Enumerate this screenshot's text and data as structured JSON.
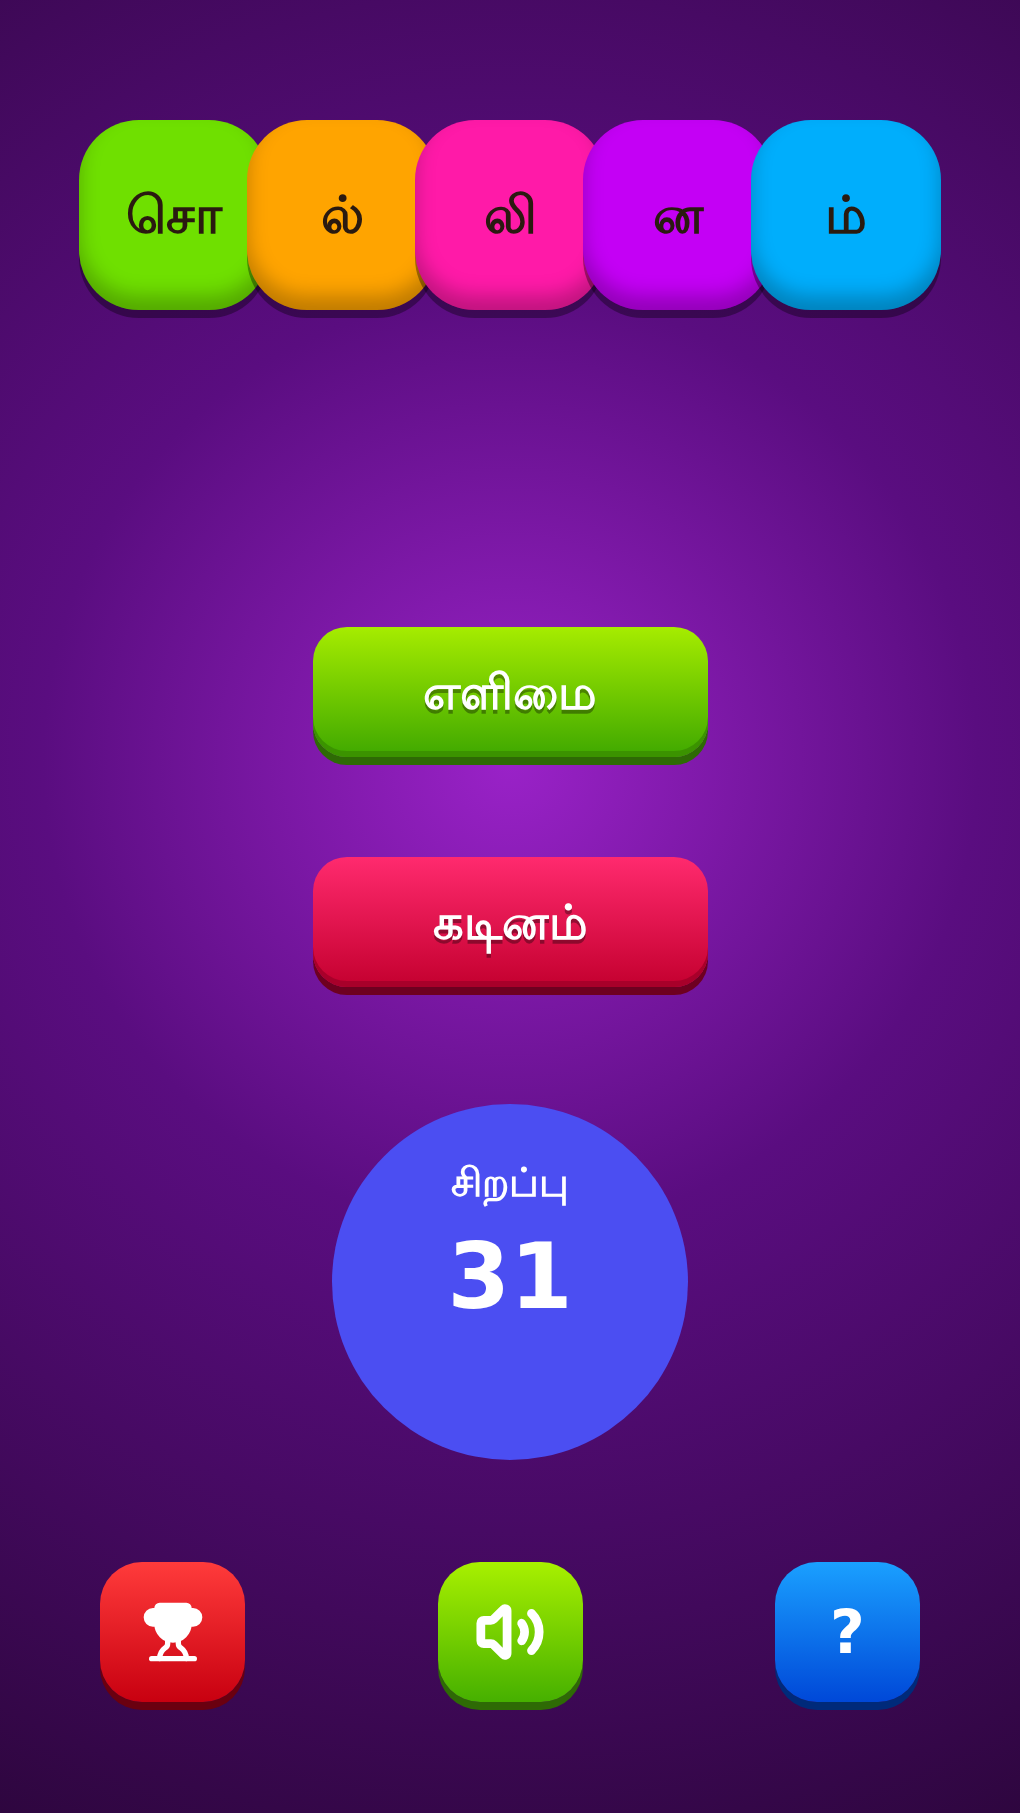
{
  "title_tiles": [
    {
      "letter": "சொ",
      "color": "#6fe000"
    },
    {
      "letter": "ல்",
      "color": "#ffa400"
    },
    {
      "letter": "லி",
      "color": "#ff1aa8"
    },
    {
      "letter": "ன",
      "color": "#c400f5"
    },
    {
      "letter": "ம்",
      "color": "#00aefc"
    }
  ],
  "difficulty_buttons": [
    {
      "label": "எளிமை",
      "kind": "easy"
    },
    {
      "label": "கடினம்",
      "kind": "hard"
    }
  ],
  "score": {
    "label": "சிறப்பு",
    "value": "31"
  },
  "bottom_buttons": [
    {
      "kind": "trophy"
    },
    {
      "kind": "sound"
    },
    {
      "kind": "help",
      "glyph": "?"
    }
  ]
}
